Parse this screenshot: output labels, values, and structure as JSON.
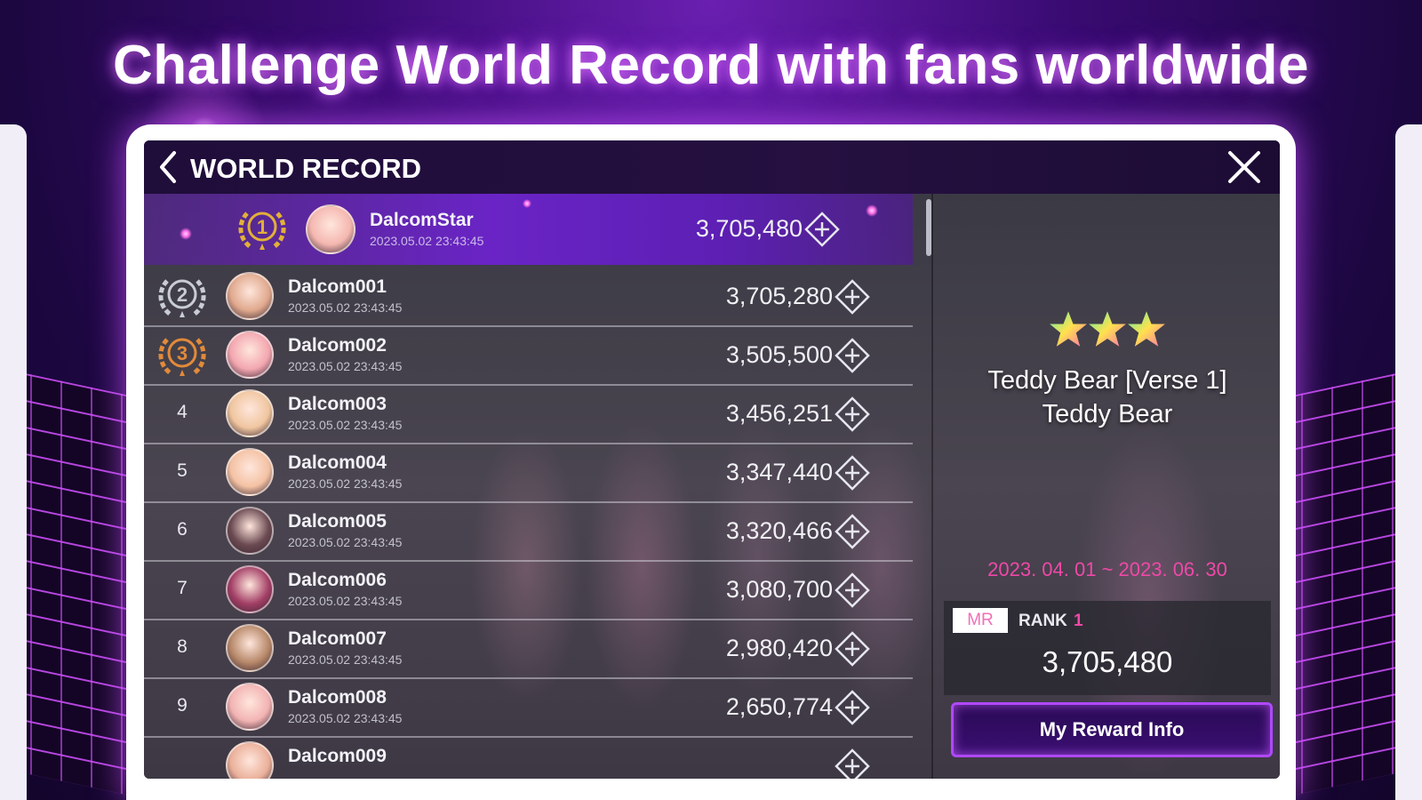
{
  "headline": "Challenge World Record with fans worldwide",
  "header": {
    "title": "WORLD RECORD"
  },
  "colors": {
    "accent": "#6a24c6",
    "highlight": "#f048a8",
    "glow": "#b048ff"
  },
  "icons": {
    "back": "chevron-left-icon",
    "close": "close-icon",
    "row_action": "diamond-plus-icon",
    "medal": "laurel-medal-icon"
  },
  "rankings": [
    {
      "rank": "1",
      "name": "DalcomStar",
      "date": "2023.05.02 23:43:45",
      "score": "3,705,480",
      "avatar_color": "#f4b7b0"
    },
    {
      "rank": "2",
      "name": "Dalcom001",
      "date": "2023.05.02 23:43:45",
      "score": "3,705,280",
      "avatar_color": "#e0a98e"
    },
    {
      "rank": "3",
      "name": "Dalcom002",
      "date": "2023.05.02 23:43:45",
      "score": "3,505,500",
      "avatar_color": "#f3a7b0"
    },
    {
      "rank": "4",
      "name": "Dalcom003",
      "date": "2023.05.02 23:43:45",
      "score": "3,456,251",
      "avatar_color": "#f0c6a0"
    },
    {
      "rank": "5",
      "name": "Dalcom004",
      "date": "2023.05.02 23:43:45",
      "score": "3,347,440",
      "avatar_color": "#f4c2a4"
    },
    {
      "rank": "6",
      "name": "Dalcom005",
      "date": "2023.05.02 23:43:45",
      "score": "3,320,466",
      "avatar_color": "#6b4a52"
    },
    {
      "rank": "7",
      "name": "Dalcom006",
      "date": "2023.05.02 23:43:45",
      "score": "3,080,700",
      "avatar_color": "#a33f66"
    },
    {
      "rank": "8",
      "name": "Dalcom007",
      "date": "2023.05.02 23:43:45",
      "score": "2,980,420",
      "avatar_color": "#b8896a"
    },
    {
      "rank": "9",
      "name": "Dalcom008",
      "date": "2023.05.02 23:43:45",
      "score": "2,650,774",
      "avatar_color": "#f2b3b3"
    },
    {
      "rank": "",
      "name": "Dalcom009",
      "date": "",
      "score": "",
      "avatar_color": "#eab09a"
    }
  ],
  "song": {
    "stars": 3,
    "title": "Teddy Bear [Verse 1]",
    "artist": "Teddy Bear",
    "period": "2023. 04. 01 ~ 2023. 06. 30"
  },
  "my_record": {
    "badge": "MR",
    "rank_label": "RANK",
    "rank_value": "1",
    "score": "3,705,480"
  },
  "reward_button": "My Reward Info"
}
